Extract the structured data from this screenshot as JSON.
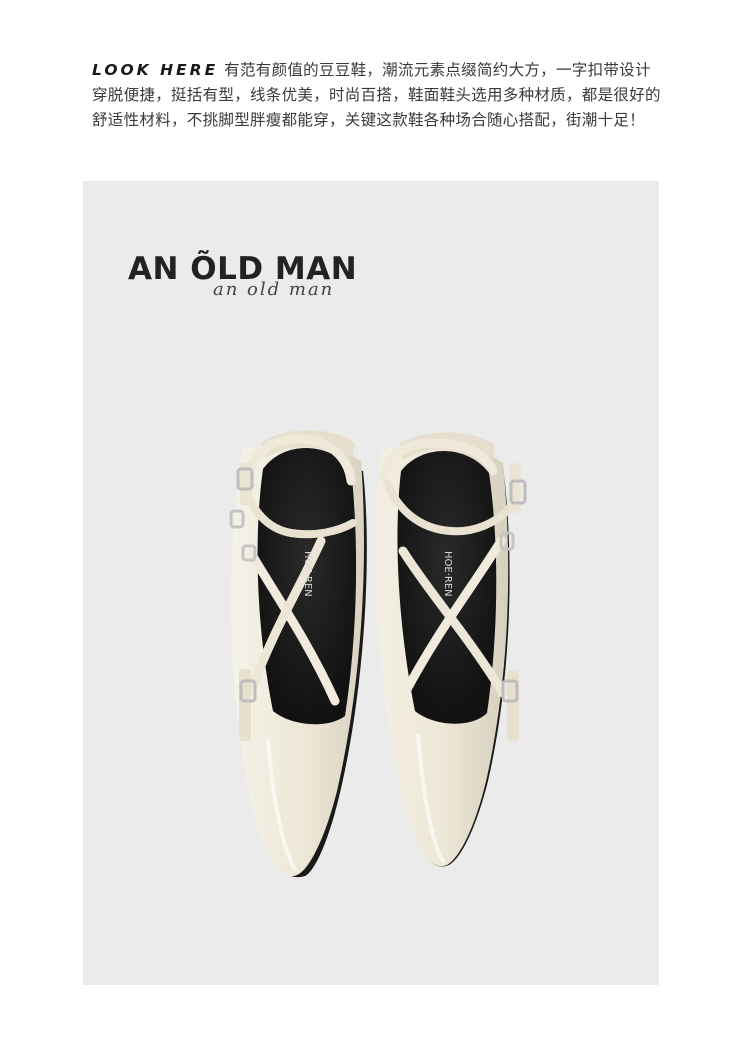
{
  "intro": {
    "lead": "LOOK HERE",
    "text": "有范有颜值的豆豆鞋，潮流元素点缀简约大方，一字扣带设计穿脱便捷，挺括有型，线条优美，时尚百搭，鞋面鞋头选用多种材质，都是很好的舒适性材料，不挑脚型胖瘦都能穿，关键这款鞋各种场合随心搭配，街潮十足！"
  },
  "brand": {
    "title": "AN ÕLD MAN",
    "script": "an old man"
  },
  "product_photo": {
    "insole_label": "HOE·REN",
    "colors": {
      "panel": "#ebebeb",
      "leather": "#ece6d6",
      "lining": "#1c1c1c",
      "buckle": "#c9c9c9"
    }
  }
}
